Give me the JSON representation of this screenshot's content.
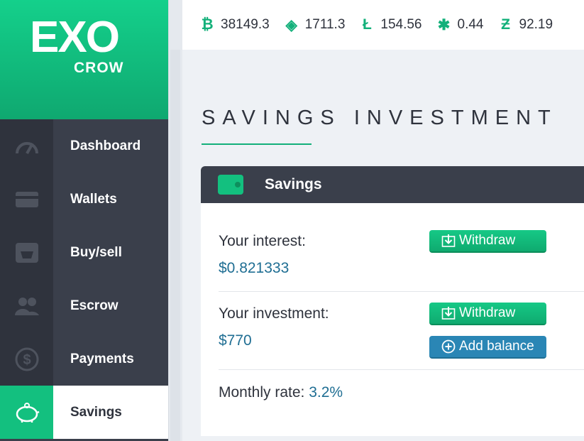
{
  "brand": {
    "logo_main": "EXO",
    "logo_sub": "CROW",
    "accent": "#13c07f",
    "sidebar_bg": "#3a3f4b"
  },
  "sidebar": {
    "items": [
      {
        "label": "Dashboard",
        "icon": "gauge-icon",
        "active": false
      },
      {
        "label": "Wallets",
        "icon": "credit-card-icon",
        "active": false
      },
      {
        "label": "Buy/sell",
        "icon": "basket-icon",
        "active": false
      },
      {
        "label": "Escrow",
        "icon": "users-icon",
        "active": false
      },
      {
        "label": "Payments",
        "icon": "dollar-coin-icon",
        "active": false
      },
      {
        "label": "Savings",
        "icon": "piggy-bank-icon",
        "active": true
      }
    ]
  },
  "ticker": [
    {
      "symbol": "btc-icon",
      "glyph": "₿",
      "value": "38149.3"
    },
    {
      "symbol": "eth-icon",
      "glyph": "◈",
      "value": "1711.3"
    },
    {
      "symbol": "ltc-icon",
      "glyph": "Ł",
      "value": "154.56"
    },
    {
      "symbol": "xrp-icon",
      "glyph": "✱",
      "value": "0.44"
    },
    {
      "symbol": "zec-icon",
      "glyph": "Ƶ",
      "value": "92.19"
    }
  ],
  "page": {
    "title": "SAVINGS INVESTMENT"
  },
  "savings_card": {
    "title": "Savings",
    "interest_label": "Your interest:",
    "interest_value": "$0.821333",
    "investment_label": "Your investment:",
    "investment_value": "$770",
    "monthly_rate_label": "Monthly rate:",
    "monthly_rate_value": "3.2%",
    "withdraw_label": "Withdraw",
    "add_balance_label": "Add balance"
  }
}
